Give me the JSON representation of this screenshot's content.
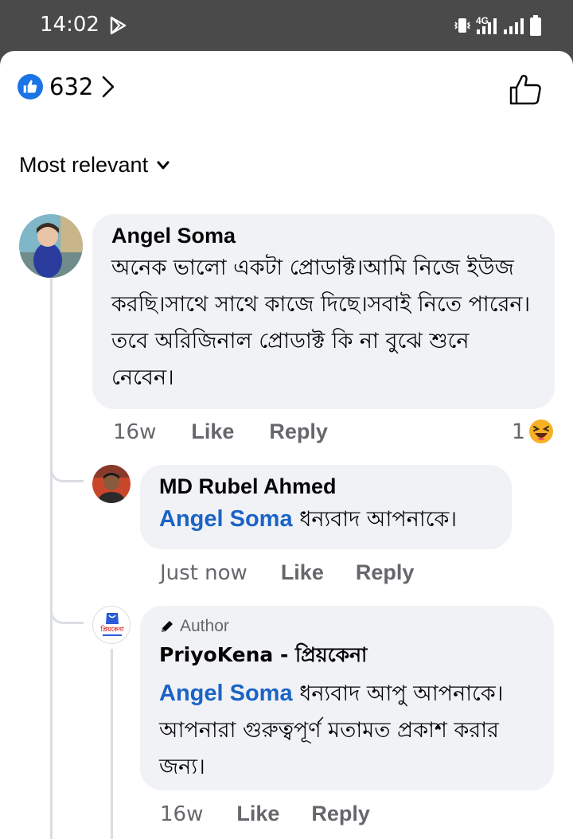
{
  "status_bar": {
    "time": "14:02",
    "network": "4G"
  },
  "header": {
    "reaction_count": "632"
  },
  "sort": {
    "label": "Most relevant"
  },
  "comments": [
    {
      "author": "Angel Soma",
      "text": "অনেক ভালো একটা প্রোডাক্ট।আমি নিজে ইউজ করছি।সাথে সাথে কাজে দিছে।সবাই নিতে পারেন।তবে অরিজিনাল প্রোডাক্ট কি না বুঝে শুনে নেবেন।",
      "time": "16w",
      "like_label": "Like",
      "reply_label": "Reply",
      "reaction_count": "1",
      "reaction_icon": "haha-emoji"
    }
  ],
  "replies": [
    {
      "author": "MD Rubel Ahmed",
      "mention": "Angel Soma",
      "text": "ধন্যবাদ আপনাকে।",
      "time": "Just now",
      "like_label": "Like",
      "reply_label": "Reply"
    },
    {
      "badge": "Author",
      "author": "PriyoKena - প্রিয়কেনা",
      "mention": "Angel Soma",
      "text": "ধন্যবাদ  আপু আপনাকে।  আপনারা গুরুত্বপূর্ণ মতামত প্রকাশ করার জন্য।",
      "time": "16w",
      "like_label": "Like",
      "reply_label": "Reply",
      "avatar_logo_text": "প্রিয়কেনা"
    }
  ],
  "colors": {
    "accent": "#1b74e4",
    "mention": "#1b63c6",
    "bubble": "#f0f2f5",
    "status_bar": "#4a4a4a"
  }
}
